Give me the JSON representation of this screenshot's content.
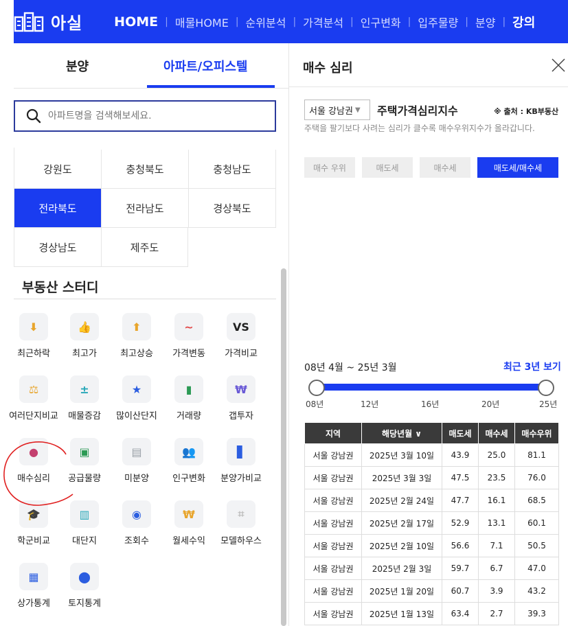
{
  "header": {
    "logo": "아실",
    "nav": [
      "HOME",
      "매물HOME",
      "순위분석",
      "가격분석",
      "인구변화",
      "입주물량",
      "분양",
      "강의"
    ]
  },
  "left": {
    "tabs": [
      "분양",
      "아파트/오피스텔"
    ],
    "search_placeholder": "아파트명을 검색해보세요.",
    "regions": [
      [
        "강원도",
        "충청북도",
        "충청남도"
      ],
      [
        "전라북도",
        "전라남도",
        "경상북도"
      ],
      [
        "경상남도",
        "제주도"
      ]
    ],
    "active_region": "전라북도",
    "study_title": "부동산 스터디",
    "study_items": [
      {
        "label": "최근하락",
        "icon": "down-arrow-coin-icon",
        "glyph": "⬇",
        "color": "#e8a52c"
      },
      {
        "label": "최고가",
        "icon": "thumbs-up-icon",
        "glyph": "👍",
        "color": "#6a8fd6"
      },
      {
        "label": "최고상승",
        "icon": "up-arrow-coin-icon",
        "glyph": "⬆",
        "color": "#e8a52c"
      },
      {
        "label": "가격변동",
        "icon": "pulse-icon",
        "glyph": "~",
        "color": "#e24b4b"
      },
      {
        "label": "가격비교",
        "icon": "versus-icon",
        "glyph": "VS",
        "color": "#222222"
      },
      {
        "label": "여러단지비교",
        "icon": "scale-icon",
        "glyph": "⚖",
        "color": "#e8a52c"
      },
      {
        "label": "매물증감",
        "icon": "plus-minus-icon",
        "glyph": "±",
        "color": "#27a7b8"
      },
      {
        "label": "많이산단지",
        "icon": "shield-star-icon",
        "glyph": "★",
        "color": "#2b5de0"
      },
      {
        "label": "거래량",
        "icon": "bar-chart-icon",
        "glyph": "▮",
        "color": "#2c9a55"
      },
      {
        "label": "갭투자",
        "icon": "money-bag-icon",
        "glyph": "₩",
        "color": "#6a5ad6"
      },
      {
        "label": "매수심리",
        "icon": "head-brain-icon",
        "glyph": "●",
        "color": "#c4406f"
      },
      {
        "label": "공급물량",
        "icon": "supply-icon",
        "glyph": "▣",
        "color": "#2c9a55"
      },
      {
        "label": "미분양",
        "icon": "sign-icon",
        "glyph": "▤",
        "color": "#9aa0a8"
      },
      {
        "label": "인구변화",
        "icon": "people-icon",
        "glyph": "👥",
        "color": "#2b7fe0"
      },
      {
        "label": "분양가비교",
        "icon": "building-icon",
        "glyph": "▋",
        "color": "#2b5de0"
      },
      {
        "label": "학군비교",
        "icon": "graduation-cap-icon",
        "glyph": "🎓",
        "color": "#222222"
      },
      {
        "label": "대단지",
        "icon": "complex-icon",
        "glyph": "▥",
        "color": "#27a7b8"
      },
      {
        "label": "조회수",
        "icon": "eye-icon",
        "glyph": "◉",
        "color": "#2b5de0"
      },
      {
        "label": "월세수익",
        "icon": "rent-bag-icon",
        "glyph": "₩",
        "color": "#e8a52c"
      },
      {
        "label": "모델하우스",
        "icon": "floorplan-icon",
        "glyph": "⌗",
        "color": "#bbbbbb"
      },
      {
        "label": "상가통계",
        "icon": "store-icon",
        "glyph": "▦",
        "color": "#2b5de0"
      },
      {
        "label": "토지통계",
        "icon": "map-pin-icon",
        "glyph": "⬤",
        "color": "#2b5de0"
      }
    ]
  },
  "right": {
    "title": "매수 심리",
    "region_select": "서울 강남권",
    "index_title": "주택가격심리지수",
    "source": "※ 출처 : KB부동산",
    "description": "주택을 팔기보다 사려는 심리가 클수록 매수우위지수가 올라갑니다.",
    "buttons": [
      "매수 우위",
      "매도세",
      "매수세",
      "매도세/매수세"
    ],
    "period": "08년 4월 ~ 25년 3월",
    "recent_link": "최근 3년 보기",
    "slider_ticks": [
      "08년",
      "12년",
      "16년",
      "20년",
      "25년"
    ],
    "table": {
      "headers": [
        "지역",
        "해당년월 ∨",
        "매도세",
        "매수세",
        "매수우위"
      ],
      "rows": [
        [
          "서울 강남권",
          "2025년 3월 10일",
          "43.9",
          "25.0",
          "81.1"
        ],
        [
          "서울 강남권",
          "2025년 3월 3일",
          "47.5",
          "23.5",
          "76.0"
        ],
        [
          "서울 강남권",
          "2025년 2월 24일",
          "47.7",
          "16.1",
          "68.5"
        ],
        [
          "서울 강남권",
          "2025년 2월 17일",
          "52.9",
          "13.1",
          "60.1"
        ],
        [
          "서울 강남권",
          "2025년 2월 10일",
          "56.6",
          "7.1",
          "50.5"
        ],
        [
          "서울 강남권",
          "2025년 2월 3일",
          "59.7",
          "6.7",
          "47.0"
        ],
        [
          "서울 강남권",
          "2025년 1월 20일",
          "60.7",
          "3.9",
          "43.2"
        ],
        [
          "서울 강남권",
          "2025년 1월 13일",
          "63.4",
          "2.7",
          "39.3"
        ]
      ]
    }
  },
  "colors": {
    "brand": "#1a3cf0",
    "annotation": "#e02020"
  }
}
